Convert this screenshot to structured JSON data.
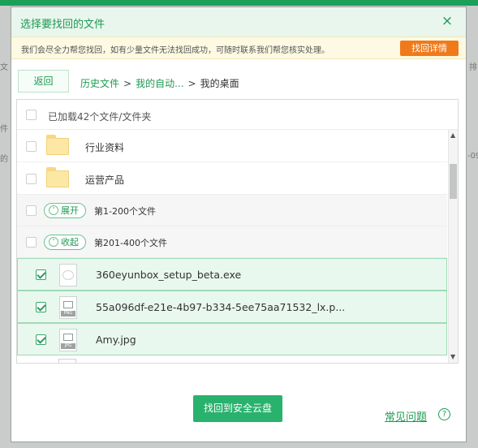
{
  "background": {
    "left_fragments": [
      "文",
      "件",
      "的"
    ],
    "right_fragments": [
      "排",
      "-09"
    ]
  },
  "dialog": {
    "title": "选择要找回的文件",
    "close_glyph": "×",
    "notice": {
      "text": "我们会尽全力帮您找回，如有少量文件无法找回成功，可随时联系我们帮您核实处理。",
      "button": "找回详情"
    },
    "back_label": "返回",
    "breadcrumb": {
      "items": [
        "历史文件",
        "我的自动...",
        "我的桌面"
      ],
      "separator": ">"
    },
    "loaded_text": "已加载42个文件/文件夹",
    "rows": [
      {
        "type": "folder",
        "name": "行业资料"
      },
      {
        "type": "folder",
        "name": "运营产品"
      },
      {
        "type": "group",
        "toggle": "展开",
        "toggle_icon": "˅",
        "name": "第1-200个文件"
      },
      {
        "type": "group",
        "toggle": "收起",
        "toggle_icon": "˄",
        "name": "第201-400个文件"
      },
      {
        "type": "file",
        "icon": "cloud-file-icon",
        "name": "360eyunbox_setup_beta.exe",
        "checked": true
      },
      {
        "type": "file",
        "icon": "png-file-icon",
        "tag": "PNG",
        "name": "55a096df-e21e-4b97-b334-5ee75aa71532_lx.p...",
        "checked": true
      },
      {
        "type": "file",
        "icon": "jpg-file-icon",
        "tag": "JPG",
        "name": "Amy.jpg",
        "checked": true
      }
    ],
    "scroll": {
      "up_glyph": "▲",
      "down_glyph": "▼"
    },
    "recover_button": "找回到安全云盘",
    "faq_link": "常见问题",
    "faq_icon": "?"
  },
  "colors": {
    "accent_green": "#1d9a52",
    "button_green": "#29b26d",
    "notice_orange": "#f07a1a",
    "selection_bg": "#e9f8ef"
  }
}
